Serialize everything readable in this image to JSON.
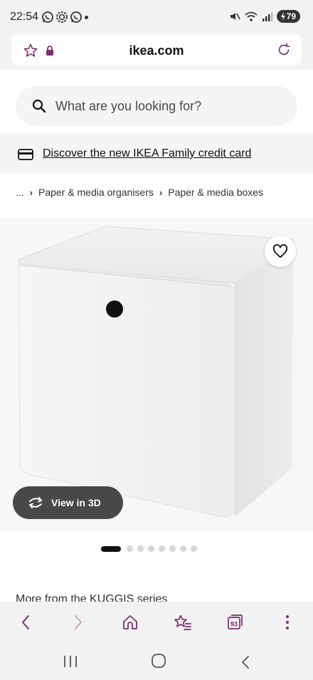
{
  "status_bar": {
    "time": "22:54",
    "battery": "79",
    "icons": [
      "whatsapp-icon",
      "signal-app-icon",
      "whatsapp-icon",
      "mute-icon",
      "wifi-icon",
      "signal-bars-icon",
      "battery-icon"
    ]
  },
  "browser": {
    "url": "ikea.com",
    "nav": [
      "back-icon",
      "forward-icon",
      "home-icon",
      "bookmarks-icon",
      "tabs-icon",
      "menu-icon"
    ],
    "tabs_count": "93"
  },
  "search": {
    "placeholder": "What are you looking for?"
  },
  "promo": {
    "text": "Discover the new IKEA Family credit card"
  },
  "breadcrumb": {
    "ellipsis": "...",
    "items": [
      "Paper & media organisers",
      "Paper & media boxes"
    ]
  },
  "product": {
    "view_3d_label": "View in 3D",
    "image_count": 8,
    "active_image": 1
  },
  "section": {
    "more_from": "More from the KUGGIS series"
  },
  "colors": {
    "accent": "#7b2d6e",
    "dark_button": "#484848"
  }
}
